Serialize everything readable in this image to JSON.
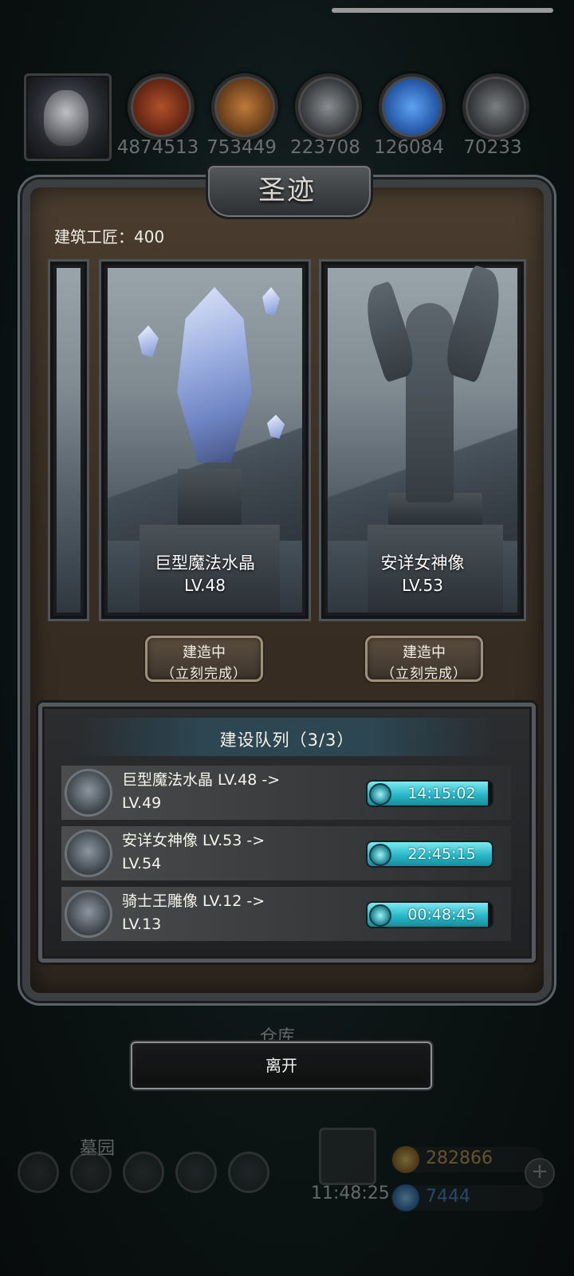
{
  "resources": [
    {
      "name": "meat",
      "value": "4874513",
      "color": "#8a3a1c"
    },
    {
      "name": "wood",
      "value": "753449",
      "color": "#8a5a2a"
    },
    {
      "name": "stone",
      "value": "223708",
      "color": "#5a5e62"
    },
    {
      "name": "crystal",
      "value": "126084",
      "color": "#2b6fd0"
    },
    {
      "name": "iron",
      "value": "70233",
      "color": "#4a4d50"
    }
  ],
  "panel": {
    "title": "圣迹",
    "craftsman": "建筑工匠：400",
    "cards": [
      {
        "name": "巨型魔法水晶",
        "level": "LV.48",
        "button_line1": "建造中",
        "button_line2": "（立刻完成）"
      },
      {
        "name": "安详女神像",
        "level": "LV.53",
        "button_line1": "建造中",
        "button_line2": "（立刻完成）"
      }
    ],
    "queue": {
      "title": "建设队列（3/3）",
      "items": [
        {
          "line1": "巨型魔法水晶 LV.48 ->",
          "line2": "LV.49",
          "timer": "14:15:02",
          "progress": 0.97
        },
        {
          "line1": "安详女神像 LV.53 ->",
          "line2": "LV.54",
          "timer": "22:45:15",
          "progress": 1.0
        },
        {
          "line1": "骑士王雕像 LV.12 ->",
          "line2": "LV.13",
          "timer": "00:48:45",
          "progress": 0.97
        }
      ]
    },
    "leave_label": "离开"
  },
  "background_hud": {
    "location_label": "墓园",
    "partial_label": "仓库",
    "gold": "282866",
    "gems": "7444",
    "clock": "11:48:25"
  },
  "colors": {
    "accent_timer": "#29b8c9",
    "panel_brown": "#3a2f24",
    "gold_text": "#c9a24a",
    "gem_text": "#3a8cd8"
  }
}
